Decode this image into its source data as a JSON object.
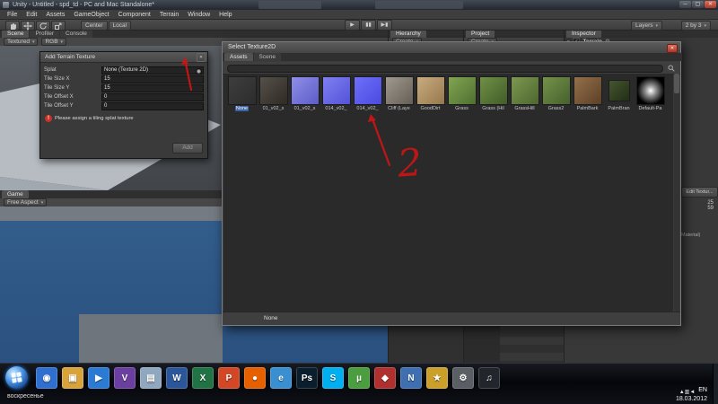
{
  "ui": {
    "arrow": "▾",
    "min": "─",
    "max": "▢",
    "close": "✕",
    "check": "✓",
    "fold": "▼",
    "gear": "⚙"
  },
  "titlebar": {
    "title": "Unity - Untitled - spd_td - PC and Mac Standalone*"
  },
  "menu": {
    "items": [
      "File",
      "Edit",
      "Assets",
      "GameObject",
      "Component",
      "Terrain",
      "Window",
      "Help"
    ]
  },
  "toolbar": {
    "pivot": "Center",
    "space": "Local",
    "play": "▶",
    "pause": "▮▮",
    "step": "▶▮",
    "layers_label": "Layers",
    "layout_label": "2 by 3"
  },
  "scene_view": {
    "tabs": [
      "Scene",
      "Profiler",
      "Console"
    ],
    "active_tab": "Scene",
    "render_mode": "Textured",
    "channel_mode": "RGB"
  },
  "game_view": {
    "tab": "Game",
    "aspect_label": "Free Aspect"
  },
  "hierarchy": {
    "tab": "Hierarchy",
    "create_label": "Create"
  },
  "project": {
    "tab": "Project",
    "create_label": "Create"
  },
  "inspector": {
    "tab": "Inspector",
    "component": "Terrain",
    "edit_texture_button": "Edit Textur...",
    "values": [
      "25",
      "59"
    ],
    "material_label": "Material)"
  },
  "add_texture_dialog": {
    "title": "Add Terrain Texture",
    "fields": [
      {
        "label": "Splat",
        "value": "None (Texture 2D)",
        "type": "object"
      },
      {
        "label": "Tile Size X",
        "value": "15",
        "type": "number"
      },
      {
        "label": "Tile Size Y",
        "value": "15",
        "type": "number"
      },
      {
        "label": "Tile Offset X",
        "value": "0",
        "type": "number"
      },
      {
        "label": "Tile Offset Y",
        "value": "0",
        "type": "number"
      }
    ],
    "warning": "Please assign a tiling splat texture",
    "add_button": "Add"
  },
  "texture_picker": {
    "title": "Select Texture2D",
    "tabs": [
      "Assets",
      "Scene"
    ],
    "active_tab": "Assets",
    "items": [
      {
        "name": "None",
        "c1": "#3e3e3e",
        "c2": "#2c2c2c",
        "selected": true
      },
      {
        "name": "01_v02_s",
        "c1": "#56504a",
        "c2": "#2e2a24"
      },
      {
        "name": "01_v02_s",
        "c1": "#8f8fe8",
        "c2": "#5c5cc8"
      },
      {
        "name": "014_v02_",
        "c1": "#8080f2",
        "c2": "#5252d8"
      },
      {
        "name": "014_v02_",
        "c1": "#6f6ffa",
        "c2": "#4a4ae0"
      },
      {
        "name": "Cliff (Laye",
        "c1": "#a09a90",
        "c2": "#645e54"
      },
      {
        "name": "GoodDirt",
        "c1": "#c8ac7e",
        "c2": "#97784e"
      },
      {
        "name": "Grass",
        "c1": "#82a452",
        "c2": "#4e7030"
      },
      {
        "name": "Grass (Hil",
        "c1": "#6f9146",
        "c2": "#425c28"
      },
      {
        "name": "GrassHill",
        "c1": "#7d9850",
        "c2": "#4c6630"
      },
      {
        "name": "Grass2",
        "c1": "#75924a",
        "c2": "#46602c"
      },
      {
        "name": "PalmBark",
        "c1": "#94704c",
        "c2": "#5c4026"
      },
      {
        "name": "PalmBran",
        "c1": "#45552f",
        "c2": "#222e16",
        "small": true
      },
      {
        "name": "Default-Pa",
        "c1": "#ffffff",
        "c2": "#000000",
        "radial": true
      }
    ],
    "status": "None"
  },
  "annotations": {
    "label_two": "2"
  },
  "taskbar": {
    "icons": [
      {
        "bg": "#2f6fd0",
        "g": "◉"
      },
      {
        "bg": "#d9a33c",
        "g": "▣"
      },
      {
        "bg": "#2b7bd4",
        "g": "▶"
      },
      {
        "bg": "#6a3fa0",
        "g": "V"
      },
      {
        "bg": "#8fa8c0",
        "g": "▤"
      },
      {
        "bg": "#2b579a",
        "g": "W"
      },
      {
        "bg": "#217346",
        "g": "X"
      },
      {
        "bg": "#d24726",
        "g": "P"
      },
      {
        "bg": "#e66000",
        "g": "●"
      },
      {
        "bg": "#3a8fd0",
        "g": "e"
      },
      {
        "bg": "#0b1e2e",
        "g": "Ps"
      },
      {
        "bg": "#00aff0",
        "g": "S"
      },
      {
        "bg": "#4a9e3f",
        "g": "µ"
      },
      {
        "bg": "#b03030",
        "g": "◆"
      },
      {
        "bg": "#3f6fb0",
        "g": "N"
      },
      {
        "bg": "#caa02a",
        "g": "★"
      },
      {
        "bg": "#5a5f66",
        "g": "⚙"
      },
      {
        "bg": "#22262c",
        "g": "♫"
      }
    ],
    "tray": {
      "day": "воскресенье",
      "icons": [
        "▲",
        "▥",
        "◄"
      ],
      "lang": "EN",
      "date": "18.03.2012"
    }
  }
}
